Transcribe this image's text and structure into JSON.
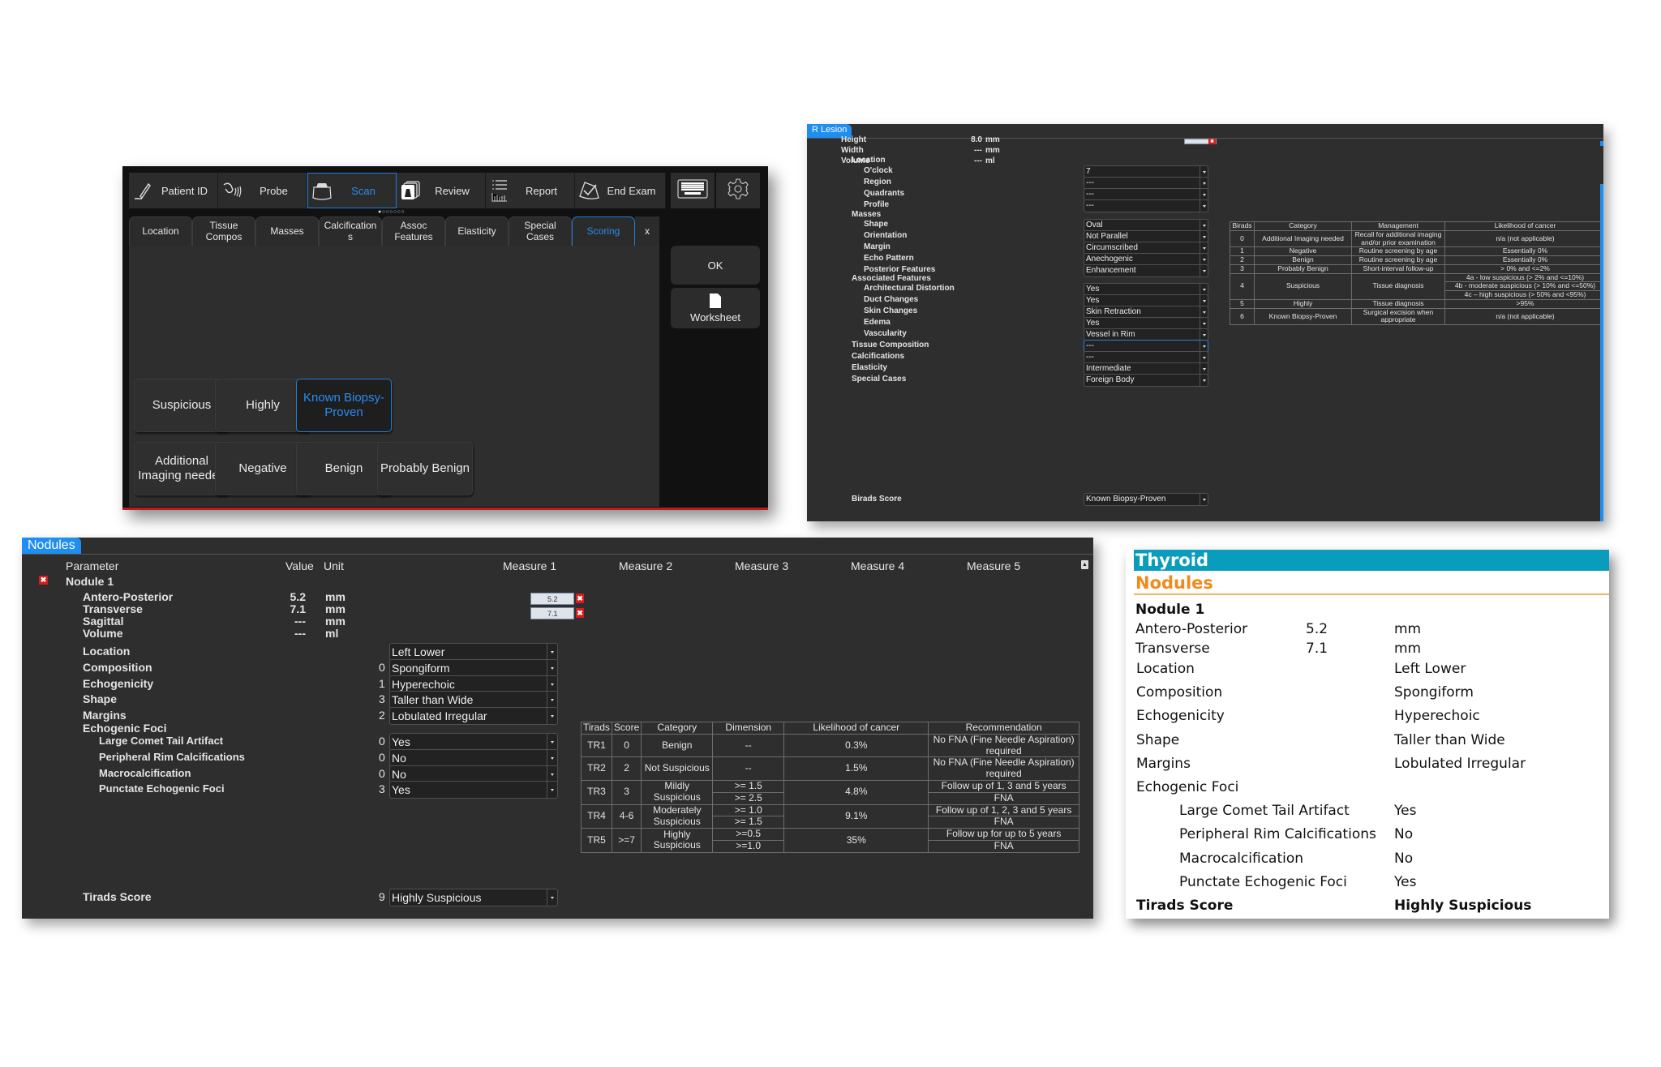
{
  "scanner": {
    "topbar": [
      {
        "label": "Patient ID",
        "icon": "pen-icon"
      },
      {
        "label": "Probe",
        "icon": "probe-icon"
      },
      {
        "label": "Scan",
        "icon": "scan-icon",
        "active": true
      },
      {
        "label": "Review",
        "icon": "review-icon"
      },
      {
        "label": "Report",
        "icon": "report-icon"
      },
      {
        "label": "End Exam",
        "icon": "end-exam-icon"
      }
    ],
    "page_dots": "●○○○○○○",
    "tabs": [
      "Location",
      "Tissue\nCompos",
      "Masses",
      "Calcification\ns",
      "Assoc\nFeatures",
      "Elasticity",
      "Special\nCases",
      "Scoring"
    ],
    "active_tab": "Scoring",
    "close_label": "x",
    "score_buttons_row1": [
      "Suspicious",
      "Highly",
      "Known Biopsy-\nProven"
    ],
    "score_buttons_row2": [
      "Additional\nImaging needed",
      "Negative",
      "Benign",
      "Probably Benign"
    ],
    "selected_score": "Known Biopsy-Proven",
    "ok_label": "OK",
    "worksheet_label": "Worksheet"
  },
  "lesion": {
    "tab": "R Lesion",
    "measurements": [
      {
        "label": "Height",
        "value": "8.0",
        "unit": "mm"
      },
      {
        "label": "Width",
        "value": "---",
        "unit": "mm"
      },
      {
        "label": "Volume",
        "value": "---",
        "unit": "ml"
      }
    ],
    "height_measure": "8.0",
    "fields": [
      {
        "label": "Location",
        "level": 0
      },
      {
        "label": "O'clock",
        "level": 1,
        "value": "7"
      },
      {
        "label": "Region",
        "level": 1,
        "value": "---"
      },
      {
        "label": "Quadrants",
        "level": 1,
        "value": "---"
      },
      {
        "label": "Profile",
        "level": 1,
        "value": "---"
      },
      {
        "label": "Masses",
        "level": 0
      },
      {
        "label": "Shape",
        "level": 1,
        "value": "Oval"
      },
      {
        "label": "Orientation",
        "level": 1,
        "value": "Not Parallel"
      },
      {
        "label": "Margin",
        "level": 1,
        "value": "Circumscribed"
      },
      {
        "label": "Echo Pattern",
        "level": 1,
        "value": "Anechogenic"
      },
      {
        "label": "Posterior Features",
        "level": 1,
        "value": "Enhancement"
      },
      {
        "label": "Associated Features",
        "level": 0
      },
      {
        "label": "Architectural Distortion",
        "level": 1,
        "value": "Yes"
      },
      {
        "label": "Duct Changes",
        "level": 1,
        "value": "Yes"
      },
      {
        "label": "Skin Changes",
        "level": 1,
        "value": "Skin Retraction"
      },
      {
        "label": "Edema",
        "level": 1,
        "value": "Yes"
      },
      {
        "label": "Vascularity",
        "level": 1,
        "value": "Vessel in Rim"
      },
      {
        "label": "Tissue Composition",
        "level": 0,
        "value": "---",
        "focused": true
      },
      {
        "label": "Calcifications",
        "level": 0,
        "value": "---"
      },
      {
        "label": "Elasticity",
        "level": 0,
        "value": "Intermediate"
      },
      {
        "label": "Special Cases",
        "level": 0,
        "value": "Foreign Body"
      }
    ],
    "score_label": "Birads Score",
    "score_value": "Known Biopsy-Proven",
    "birads_table": {
      "headers": [
        "Birads",
        "Category",
        "Management",
        "Likelihood of cancer"
      ],
      "rows": [
        {
          "birads": "0",
          "category": "Additional Imaging needed",
          "management": "Recall for additional imaging and/or prior examination",
          "likelihood": [
            "n/a (not applicable)"
          ]
        },
        {
          "birads": "1",
          "category": "Negative",
          "management": "Routine screening by age",
          "likelihood": [
            "Essentially 0%"
          ]
        },
        {
          "birads": "2",
          "category": "Benign",
          "management": "Routine screening by age",
          "likelihood": [
            "Essentially 0%"
          ]
        },
        {
          "birads": "3",
          "category": "Probably Benign",
          "management": "Short-interval follow-up",
          "likelihood": [
            "> 0% and <=2%"
          ]
        },
        {
          "birads": "4",
          "category": "Suspicious",
          "management": "Tissue diagnosis",
          "likelihood": [
            "4a - low suspicious (> 2% and <=10%)",
            "4b - moderate suspicious (> 10% and <=50%)",
            "4c – high suspicious (> 50% and <95%)"
          ]
        },
        {
          "birads": "5",
          "category": "Highly",
          "management": "Tissue diagnosis",
          "likelihood": [
            ">95%"
          ]
        },
        {
          "birads": "6",
          "category": "Known Biopsy-Proven",
          "management": "Surgical excision when appropriate",
          "likelihood": [
            "n/a (not applicable)"
          ]
        }
      ]
    }
  },
  "nodules": {
    "tab": "Nodules",
    "headers": {
      "parameter": "Parameter",
      "value": "Value",
      "unit": "Unit",
      "measures": [
        "Measure 1",
        "Measure 2",
        "Measure 3",
        "Measure 4",
        "Measure 5"
      ]
    },
    "nodule_name": "Nodule 1",
    "measurements": [
      {
        "label": "Antero-Posterior",
        "value": "5.2",
        "unit": "mm",
        "measure1": "5.2"
      },
      {
        "label": "Transverse",
        "value": "7.1",
        "unit": "mm",
        "measure1": "7.1"
      },
      {
        "label": "Sagittal",
        "value": "---",
        "unit": "mm"
      },
      {
        "label": "Volume",
        "value": "---",
        "unit": "ml"
      }
    ],
    "fields": [
      {
        "label": "Location",
        "level": 0,
        "score": "",
        "value": "Left Lower"
      },
      {
        "label": "Composition",
        "level": 0,
        "score": "0",
        "value": "Spongiform"
      },
      {
        "label": "Echogenicity",
        "level": 0,
        "score": "1",
        "value": "Hyperechoic"
      },
      {
        "label": "Shape",
        "level": 0,
        "score": "3",
        "value": "Taller than Wide"
      },
      {
        "label": "Margins",
        "level": 0,
        "score": "2",
        "value": "Lobulated Irregular"
      },
      {
        "label": "Echogenic Foci",
        "level": 0
      },
      {
        "label": "Large Comet Tail Artifact",
        "level": 1,
        "score": "0",
        "value": "Yes"
      },
      {
        "label": "Peripheral Rim Calcifications",
        "level": 1,
        "score": "0",
        "value": "No"
      },
      {
        "label": "Macrocalcification",
        "level": 1,
        "score": "0",
        "value": "No"
      },
      {
        "label": "Punctate Echogenic Foci",
        "level": 1,
        "score": "3",
        "value": "Yes"
      }
    ],
    "score_label": "Tirads Score",
    "score_points": "9",
    "score_value": "Highly Suspicious",
    "tirads_table": {
      "headers": [
        "Tirads",
        "Score",
        "Category",
        "Dimension",
        "Likelihood of cancer",
        "Recommendation"
      ],
      "rows": [
        {
          "tirads": "TR1",
          "score": "0",
          "category": "Benign",
          "likelihood": "0.3%",
          "sub": [
            {
              "dimension": "--",
              "recommendation": "No FNA (Fine Needle Aspiration) required"
            }
          ]
        },
        {
          "tirads": "TR2",
          "score": "2",
          "category": "Not Suspicious",
          "likelihood": "1.5%",
          "sub": [
            {
              "dimension": "--",
              "recommendation": "No FNA (Fine Needle Aspiration) required"
            }
          ]
        },
        {
          "tirads": "TR3",
          "score": "3",
          "category": "Mildly Suspicious",
          "likelihood": "4.8%",
          "sub": [
            {
              "dimension": ">= 1.5",
              "recommendation": "Follow up of 1, 3 and 5 years"
            },
            {
              "dimension": ">= 2.5",
              "recommendation": "FNA"
            }
          ]
        },
        {
          "tirads": "TR4",
          "score": "4-6",
          "category": "Moderately Suspicious",
          "likelihood": "9.1%",
          "sub": [
            {
              "dimension": ">= 1.0",
              "recommendation": "Follow up of 1, 2, 3 and 5 years"
            },
            {
              "dimension": ">= 1.5",
              "recommendation": "FNA"
            }
          ]
        },
        {
          "tirads": "TR5",
          "score": ">=7",
          "category": "Highly Suspicious",
          "likelihood": "35%",
          "sub": [
            {
              "dimension": ">=0.5",
              "recommendation": "Follow up for up to 5 years"
            },
            {
              "dimension": ">=1.0",
              "recommendation": "FNA"
            }
          ]
        }
      ]
    }
  },
  "report": {
    "title": "Thyroid",
    "section": "Nodules",
    "nodule_name": "Nodule 1",
    "measurements": [
      {
        "label": "Antero-Posterior",
        "value": "5.2",
        "unit": "mm"
      },
      {
        "label": "Transverse",
        "value": "7.1",
        "unit": "mm"
      }
    ],
    "fields": [
      {
        "label": "Location",
        "value": "Left Lower",
        "level": 0
      },
      {
        "label": "Composition",
        "value": "Spongiform",
        "level": 0
      },
      {
        "label": "Echogenicity",
        "value": "Hyperechoic",
        "level": 0
      },
      {
        "label": "Shape",
        "value": "Taller than Wide",
        "level": 0
      },
      {
        "label": "Margins",
        "value": "Lobulated Irregular",
        "level": 0
      },
      {
        "label": "Echogenic Foci",
        "value": "",
        "level": 0
      },
      {
        "label": "Large Comet Tail Artifact",
        "value": "Yes",
        "level": 1
      },
      {
        "label": "Peripheral Rim Calcifications",
        "value": "No",
        "level": 1
      },
      {
        "label": "Macrocalcification",
        "value": "No",
        "level": 1
      },
      {
        "label": "Punctate Echogenic Foci",
        "value": "Yes",
        "level": 1
      }
    ],
    "score_label": "Tirads Score",
    "score_value": "Highly Suspicious"
  },
  "colors": {
    "accent_blue": "#1e8ef0",
    "report_bar": "#0a9cbc",
    "report_section": "#f08a1c",
    "delete_red": "#d81b1b"
  }
}
